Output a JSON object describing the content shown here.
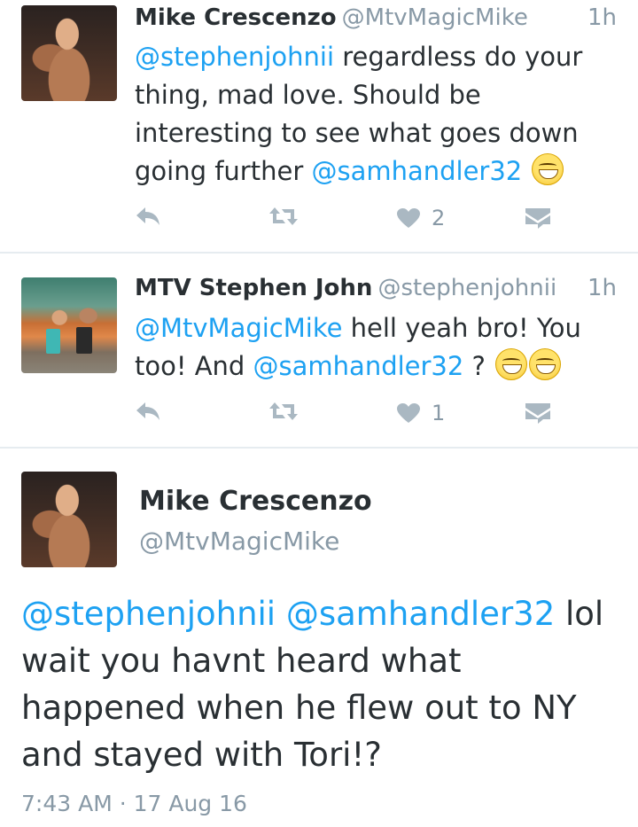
{
  "tweets": [
    {
      "name": "Mike Crescenzo",
      "handle": "@MtvMagicMike",
      "time": "1h",
      "mention1": "@stephenjohnii",
      "text1": " regardless do your thing, mad love. Should be interesting to see what goes down going further ",
      "mention2": "@samhandler32",
      "emoji": "grinning-face-emoji",
      "likes": "2",
      "avatar": "mike-avatar"
    },
    {
      "name": "MTV Stephen John",
      "handle": "@stephenjohnii",
      "time": "1h",
      "mention1": "@MtvMagicMike",
      "text1": " hell yeah bro! You too! And ",
      "mention2": "@samhandler32",
      "text2": " ? ",
      "emoji": "grinning-face-emoji",
      "likes": "1",
      "avatar": "stephen-avatar"
    }
  ],
  "detail": {
    "name": "Mike Crescenzo",
    "handle": "@MtvMagicMike",
    "mention1": "@stephenjohnii",
    "mention2": "@samhandler32",
    "text": " lol wait you havnt heard what happened when he flew out to NY and stayed with Tori!?",
    "timestamp": "7:43 AM · 17 Aug 16"
  },
  "icons": {
    "reply": "reply-icon",
    "retweet": "retweet-icon",
    "like": "heart-icon",
    "dm": "direct-message-icon"
  },
  "colors": {
    "link": "#1da1f2",
    "text": "#292f33",
    "muted": "#8899a6",
    "icon": "#aab8c2"
  }
}
